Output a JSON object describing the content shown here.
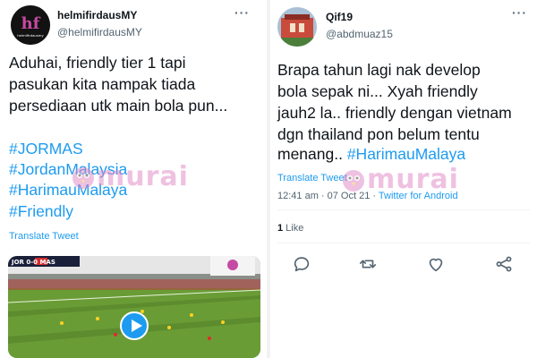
{
  "left_tweet": {
    "display_name": "helmifirdausMY",
    "handle": "@helmifirdausMY",
    "avatar_text": "helmifirdausmy",
    "text_lines": [
      "Aduhai, friendly tier 1 tapi",
      "pasukan kita nampak tiada",
      "persediaan utk main bola pun..."
    ],
    "hashtags": [
      "#JORMAS",
      "#JordanMalaysia",
      "#HarimauMalaya",
      "#Friendly"
    ],
    "translate_label": "Translate Tweet",
    "video": {
      "scoreboard": "JOR 0-0 MAS"
    }
  },
  "right_tweet": {
    "display_name": "Qif19",
    "handle": "@abdmuaz15",
    "text_lines": [
      "Brapa tahun lagi nak develop",
      "bola sepak ni...  Xyah friendly",
      "jauh2 la.. friendly dengan vietnam",
      "dgn thailand pon belum tentu"
    ],
    "last_line_text": "menang.. ",
    "last_line_tag": "#HarimauMalaya",
    "translate_label": "Translate Tweet",
    "timestamp": "12:41 am · 07 Oct 21 · ",
    "source": "Twitter for Android",
    "like_count": "1",
    "like_label": " Like"
  },
  "watermark": {
    "text": "murai"
  },
  "more_label": "···",
  "colors": {
    "link": "#1d9bf0",
    "text": "#0f1419",
    "muted": "#536471",
    "watermark": "#e084c4"
  },
  "icons": [
    "reply-icon",
    "retweet-icon",
    "like-icon",
    "share-icon",
    "more-icon",
    "play-icon"
  ]
}
